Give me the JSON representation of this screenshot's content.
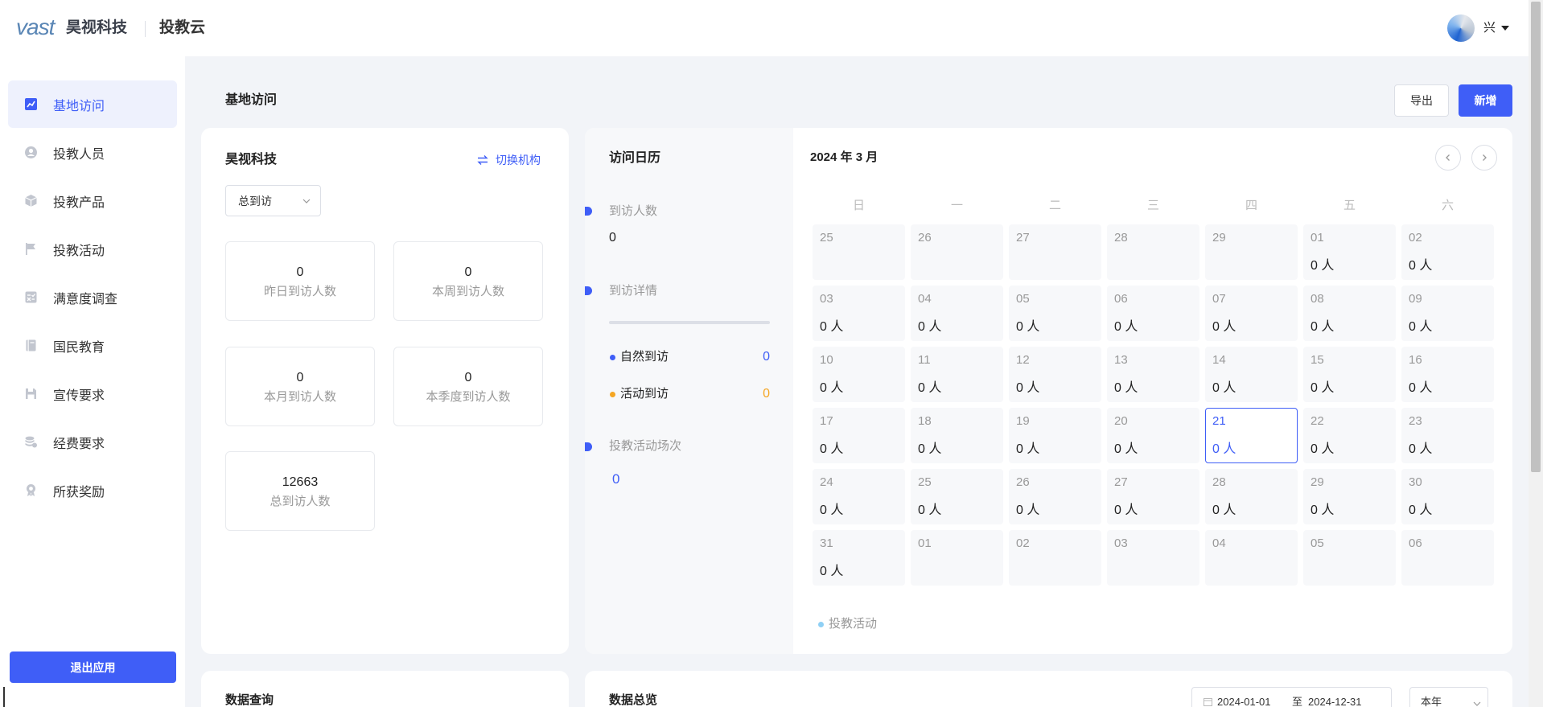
{
  "header": {
    "logo_mark": "vast",
    "logo_name": "昊视科技",
    "app_name": "投教云",
    "user_name": "兴"
  },
  "sidebar": {
    "items": [
      {
        "label": "基地访问",
        "icon": "chart-icon",
        "active": true
      },
      {
        "label": "投教人员",
        "icon": "user-circle-icon",
        "active": false
      },
      {
        "label": "投教产品",
        "icon": "cube-icon",
        "active": false
      },
      {
        "label": "投教活动",
        "icon": "flag-icon",
        "active": false
      },
      {
        "label": "满意度调查",
        "icon": "survey-icon",
        "active": false
      },
      {
        "label": "国民教育",
        "icon": "book-icon",
        "active": false
      },
      {
        "label": "宣传要求",
        "icon": "save-icon",
        "active": false
      },
      {
        "label": "经费要求",
        "icon": "coins-icon",
        "active": false
      },
      {
        "label": "所获奖励",
        "icon": "medal-icon",
        "active": false
      }
    ],
    "logout_label": "退出应用"
  },
  "page": {
    "title": "基地访问",
    "export_label": "导出",
    "add_label": "新增"
  },
  "org_card": {
    "org_name": "昊视科技",
    "switch_label": "切换机构",
    "filter_value": "总到访",
    "stats": [
      {
        "value": "0",
        "label": "昨日到访人数"
      },
      {
        "value": "0",
        "label": "本周到访人数"
      },
      {
        "value": "0",
        "label": "本月到访人数"
      },
      {
        "value": "0",
        "label": "本季度到访人数"
      },
      {
        "value": "12663",
        "label": "总到访人数"
      }
    ]
  },
  "visit_panel": {
    "title": "访问日历",
    "visitors_label": "到访人数",
    "visitors_value": "0",
    "details_label": "到访详情",
    "natural_label": "自然到访",
    "natural_value": "0",
    "activity_label": "活动到访",
    "activity_value": "0",
    "sessions_label": "投教活动场次",
    "sessions_value": "0"
  },
  "calendar": {
    "month_label": "2024 年 3 月",
    "weekdays": [
      "日",
      "一",
      "二",
      "三",
      "四",
      "五",
      "六"
    ],
    "weeks": [
      [
        {
          "day": "25",
          "count": ""
        },
        {
          "day": "26",
          "count": ""
        },
        {
          "day": "27",
          "count": ""
        },
        {
          "day": "28",
          "count": ""
        },
        {
          "day": "29",
          "count": ""
        },
        {
          "day": "01",
          "count": "0 人"
        },
        {
          "day": "02",
          "count": "0 人"
        }
      ],
      [
        {
          "day": "03",
          "count": "0 人"
        },
        {
          "day": "04",
          "count": "0 人"
        },
        {
          "day": "05",
          "count": "0 人"
        },
        {
          "day": "06",
          "count": "0 人"
        },
        {
          "day": "07",
          "count": "0 人"
        },
        {
          "day": "08",
          "count": "0 人"
        },
        {
          "day": "09",
          "count": "0 人"
        }
      ],
      [
        {
          "day": "10",
          "count": "0 人"
        },
        {
          "day": "11",
          "count": "0 人"
        },
        {
          "day": "12",
          "count": "0 人"
        },
        {
          "day": "13",
          "count": "0 人"
        },
        {
          "day": "14",
          "count": "0 人"
        },
        {
          "day": "15",
          "count": "0 人"
        },
        {
          "day": "16",
          "count": "0 人"
        }
      ],
      [
        {
          "day": "17",
          "count": "0 人"
        },
        {
          "day": "18",
          "count": "0 人"
        },
        {
          "day": "19",
          "count": "0 人"
        },
        {
          "day": "20",
          "count": "0 人"
        },
        {
          "day": "21",
          "count": "0 人",
          "selected": true
        },
        {
          "day": "22",
          "count": "0 人"
        },
        {
          "day": "23",
          "count": "0 人"
        }
      ],
      [
        {
          "day": "24",
          "count": "0 人"
        },
        {
          "day": "25",
          "count": "0 人"
        },
        {
          "day": "26",
          "count": "0 人"
        },
        {
          "day": "27",
          "count": "0 人"
        },
        {
          "day": "28",
          "count": "0 人"
        },
        {
          "day": "29",
          "count": "0 人"
        },
        {
          "day": "30",
          "count": "0 人"
        }
      ],
      [
        {
          "day": "31",
          "count": "0 人"
        },
        {
          "day": "01",
          "count": ""
        },
        {
          "day": "02",
          "count": ""
        },
        {
          "day": "03",
          "count": ""
        },
        {
          "day": "04",
          "count": ""
        },
        {
          "day": "05",
          "count": ""
        },
        {
          "day": "06",
          "count": ""
        }
      ]
    ],
    "legend_label": "投教活动"
  },
  "bottom": {
    "query_title": "数据查询",
    "overview_title": "数据总览",
    "date_start": "2024-01-01",
    "date_sep": "至",
    "date_end": "2024-12-31",
    "range_value": "本年"
  },
  "colors": {
    "accent": "#3f5ef7",
    "activity_orange": "#f5a623",
    "legend_dot": "#8fd0f5",
    "page_bg": "#f2f4f8"
  }
}
